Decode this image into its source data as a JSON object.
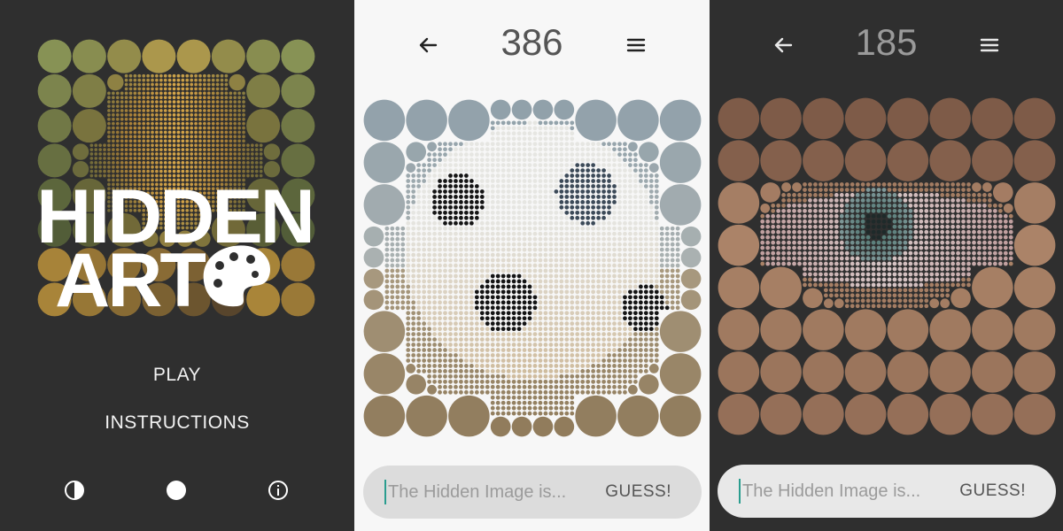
{
  "home": {
    "logo": {
      "line1": "HIDDEN",
      "line2": "ART"
    },
    "menu": {
      "play": "PLAY",
      "instructions": "INSTRUCTIONS"
    },
    "icons": [
      "contrast-icon",
      "circle-icon",
      "info-icon"
    ]
  },
  "game1": {
    "counter": "386",
    "input_placeholder": "The Hidden Image is...",
    "guess_label": "GUESS!",
    "subject": "dog"
  },
  "game2": {
    "counter": "185",
    "input_placeholder": "The Hidden Image is...",
    "guess_label": "GUESS!",
    "subject": "eye"
  },
  "colors": {
    "dark_bg": "#2f2f2f",
    "light_bg": "#f7f7f7",
    "accent": "#2a9d8f"
  }
}
